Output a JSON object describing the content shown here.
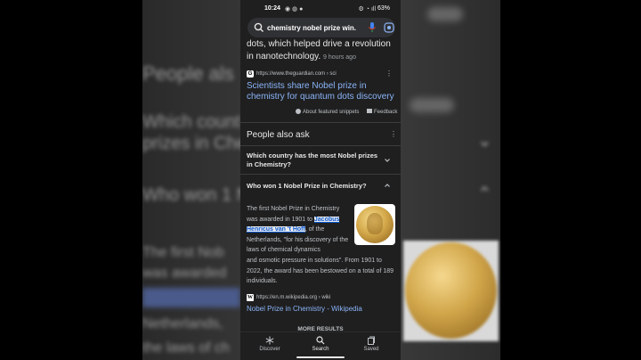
{
  "status_bar": {
    "time": "10:24",
    "battery": "63%"
  },
  "search": {
    "query": "chemistry nobel prize win..."
  },
  "snippet": {
    "text": "dots, which helped drive a revolution in nanotechnology.",
    "age": "9 hours ago"
  },
  "result": {
    "url": "https://www.theguardian.com › sci",
    "title": "Scientists share Nobel prize in chemistry for quantum dots discovery"
  },
  "featured_snippet": {
    "about_label": "About featured snippets",
    "feedback_label": "Feedback"
  },
  "paa": {
    "title": "People also ask",
    "questions": [
      "Which country has the most Nobel prizes in Chemistry?",
      "Who won 1 Nobel Prize in Chemistry?"
    ],
    "answer": {
      "pre": "The first Nobel Prize in Chemistry was awarded in 1901 to ",
      "highlight": "Jacobus Henricus van 't Hoff",
      "post1": ", of the Netherlands, \"for his discovery of the laws of chemical dynamics",
      "post2": "and osmotic pressure in solutions\". From 1901 to 2022, the award has been bestowed on a total of 189 individuals."
    },
    "source_url": "https://en.m.wikipedia.org › wiki",
    "source_title": "Nobel Prize in Chemistry - Wikipedia"
  },
  "more_results": "MORE RESULTS",
  "nav": {
    "discover": "Discover",
    "search": "Search",
    "saved": "Saved"
  },
  "colors": {
    "link": "#8ab4f8",
    "background": "#1f1f1f",
    "highlight": "#e8eaed"
  }
}
